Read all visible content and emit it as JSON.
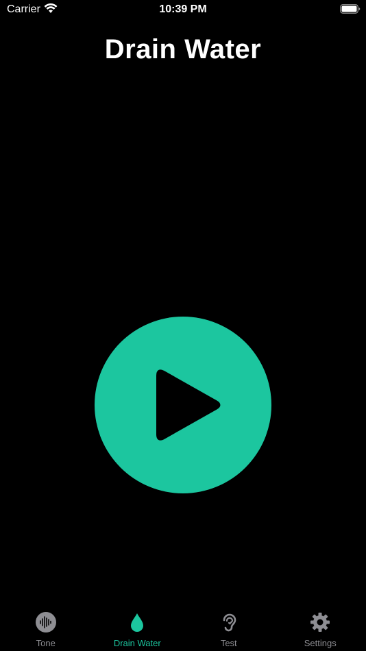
{
  "status_bar": {
    "carrier": "Carrier",
    "time": "10:39 PM"
  },
  "page": {
    "title": "Drain Water"
  },
  "colors": {
    "accent": "#1CC69F",
    "inactive": "#8E8E93",
    "background": "#000000"
  },
  "play_button": {
    "icon": "play-icon"
  },
  "tabs": [
    {
      "label": "Tone",
      "icon": "waveform-icon",
      "active": false
    },
    {
      "label": "Drain Water",
      "icon": "drop-icon",
      "active": true
    },
    {
      "label": "Test",
      "icon": "ear-icon",
      "active": false
    },
    {
      "label": "Settings",
      "icon": "gear-icon",
      "active": false
    }
  ]
}
